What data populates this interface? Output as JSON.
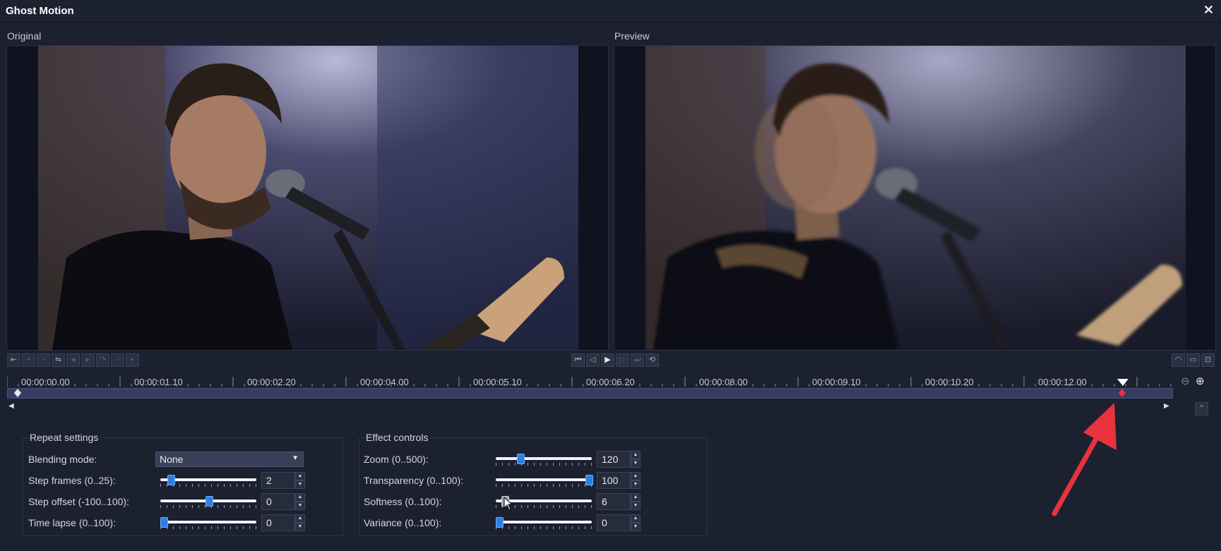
{
  "window": {
    "title": "Ghost Motion",
    "close_glyph": "✕"
  },
  "panes": {
    "original_label": "Original",
    "preview_label": "Preview"
  },
  "timeline": {
    "ticks": [
      "00:00:00.00",
      "00:00:01.10",
      "00:00:02.20",
      "00:00:04.00",
      "00:00:05.10",
      "00:00:06.20",
      "00:00:08.00",
      "00:00:09.10",
      "00:00:10.20",
      "00:00:12.00"
    ]
  },
  "repeat_settings": {
    "title": "Repeat settings",
    "blending_label": "Blending mode:",
    "blending_value": "None",
    "step_frames": {
      "label": "Step frames (0..25):",
      "value": "2",
      "level": 0.08
    },
    "step_offset": {
      "label": "Step offset (-100..100):",
      "value": "0",
      "level": 0.5
    },
    "time_lapse": {
      "label": "Time lapse (0..100):",
      "value": "0",
      "level": 0.0
    }
  },
  "effect_controls": {
    "title": "Effect controls",
    "zoom": {
      "label": "Zoom (0..500):",
      "value": "120",
      "level": 0.24
    },
    "transparency": {
      "label": "Transparency (0..100):",
      "value": "100",
      "level": 1.0
    },
    "softness": {
      "label": "Softness (0..100):",
      "value": "6",
      "level": 0.06
    },
    "variance": {
      "label": "Variance (0..100):",
      "value": "0",
      "level": 0.0
    }
  },
  "colors": {
    "accent": "#2f7fe0",
    "annotation_arrow": "#e8333c",
    "track": "#363c63"
  }
}
